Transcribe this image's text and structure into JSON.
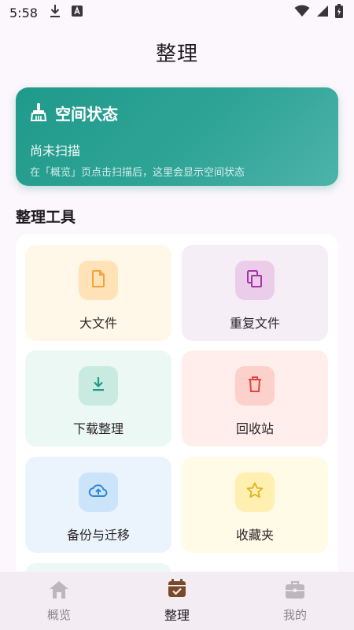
{
  "status_bar": {
    "time": "5:58",
    "icons": [
      "download-icon",
      "a-box-icon",
      "wifi-icon",
      "signal-icon",
      "battery-icon"
    ]
  },
  "header": {
    "title": "整理"
  },
  "space_card": {
    "title": "空间状态",
    "status": "尚未扫描",
    "hint": "在「概览」页点击扫描后，这里会显示空间状态",
    "icon": "broom-icon"
  },
  "tools_section": {
    "title": "整理工具",
    "items": [
      {
        "label": "大文件",
        "icon": "file-icon",
        "bg": "#FFF7E8",
        "icon_bg": "#FFE2B5",
        "icon_color": "#F2A33A"
      },
      {
        "label": "重复文件",
        "icon": "copy-icon",
        "bg": "#F5EEF6",
        "icon_bg": "#EBCDEA",
        "icon_color": "#A534A6"
      },
      {
        "label": "下载整理",
        "icon": "download-icon",
        "bg": "#ECF8F4",
        "icon_bg": "#C9EAE1",
        "icon_color": "#1E9A84"
      },
      {
        "label": "回收站",
        "icon": "trash-icon",
        "bg": "#FFEEEB",
        "icon_bg": "#FCD0CB",
        "icon_color": "#E0473C"
      },
      {
        "label": "备份与迁移",
        "icon": "cloud-upload-icon",
        "bg": "#EBF4FD",
        "icon_bg": "#CCE4FA",
        "icon_color": "#2E86D6"
      },
      {
        "label": "收藏夹",
        "icon": "star-icon",
        "bg": "#FFFBE6",
        "icon_bg": "#FFEFB0",
        "icon_color": "#E0B21A"
      },
      {
        "label": "",
        "icon": "",
        "bg": "#ECF8F4",
        "icon_bg": "#C9EAE1",
        "icon_color": "#1E9A84"
      }
    ]
  },
  "bottom_nav": {
    "items": [
      {
        "label": "概览",
        "icon": "home-icon",
        "active": false
      },
      {
        "label": "整理",
        "icon": "calendar-check-icon",
        "active": true
      },
      {
        "label": "我的",
        "icon": "briefcase-icon",
        "active": false
      }
    ]
  },
  "colors": {
    "accent": "#1F9A8A",
    "nav_active": "#7A4A28",
    "nav_inactive": "#BDB7BC"
  }
}
